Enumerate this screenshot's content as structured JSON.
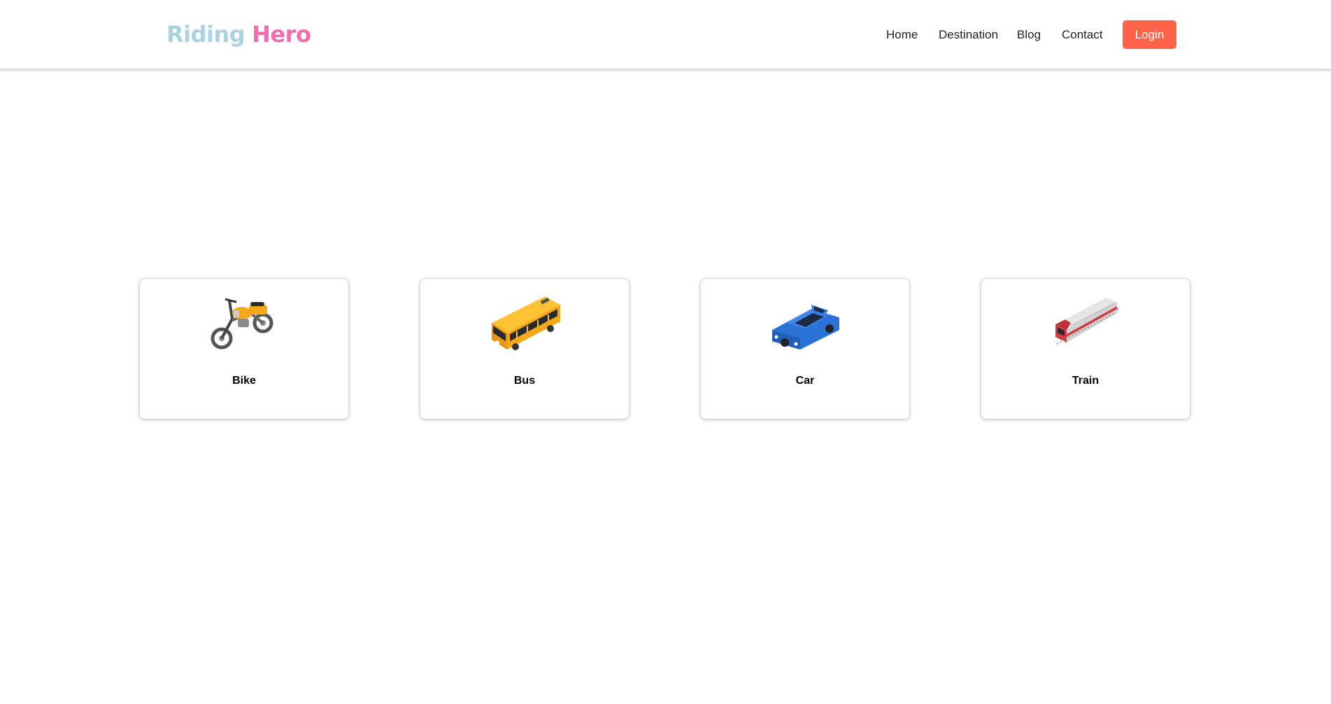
{
  "brand": {
    "first": "Riding",
    "second": "Hero"
  },
  "nav": {
    "home": "Home",
    "destination": "Destination",
    "blog": "Blog",
    "contact": "Contact",
    "login": "Login"
  },
  "vehicles": [
    {
      "label": "Bike",
      "icon": "motorcycle-icon"
    },
    {
      "label": "Bus",
      "icon": "bus-icon"
    },
    {
      "label": "Car",
      "icon": "car-icon"
    },
    {
      "label": "Train",
      "icon": "train-icon"
    }
  ],
  "colors": {
    "brand_first": "#a9d3e0",
    "brand_second": "#f06daf",
    "login_button": "#ff6347"
  }
}
